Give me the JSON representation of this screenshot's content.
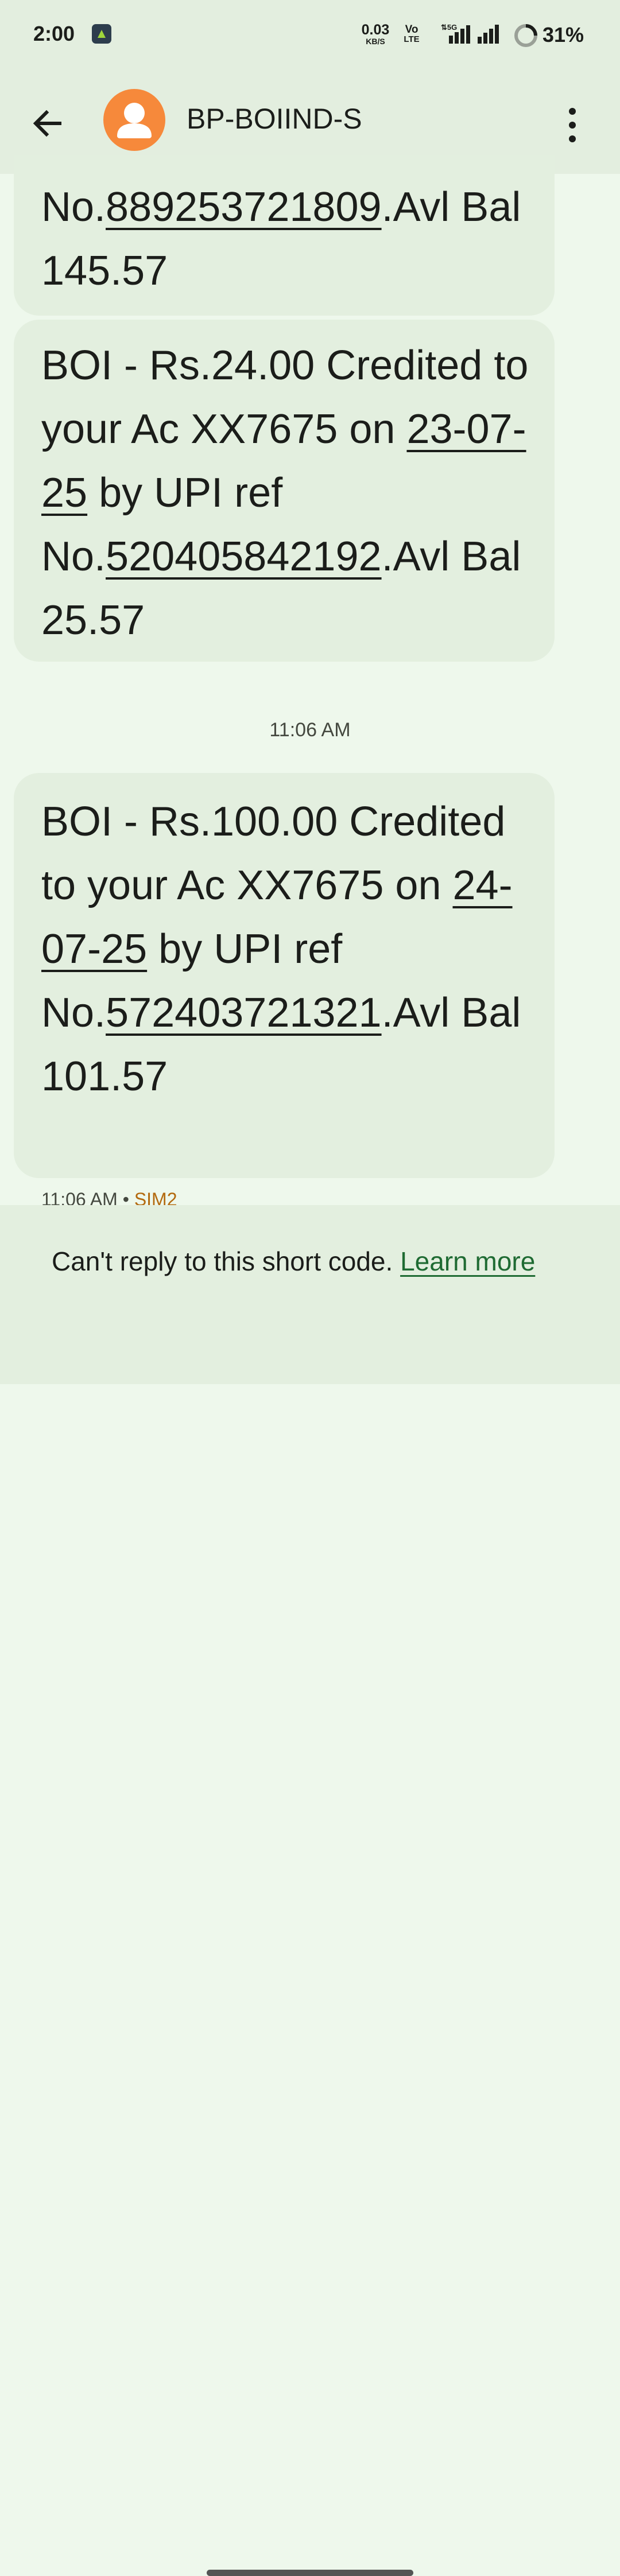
{
  "status_bar": {
    "time": "2:00",
    "net_speed_value": "0.03",
    "net_speed_unit": "KB/S",
    "volte_top": "Vo",
    "volte_bottom": "LTE",
    "network_type": "5G",
    "battery_percent": "31%"
  },
  "header": {
    "title": "BP-BOIIND-S",
    "avatar_color": "#f6893b"
  },
  "messages": [
    {
      "text_before_ref": "No.",
      "ref": "889253721809",
      "text_after_ref": ".Avl Bal 145.57"
    },
    {
      "prefix": "BOI -  Rs.24.00 Credited to your Ac XX7675 on ",
      "date": "23-07-25",
      "middle": " by UPI ref No.",
      "ref": "520405842192",
      "suffix": ".Avl Bal 25.57"
    },
    {
      "prefix": "BOI -  Rs.100.00 Credited to your Ac XX7675 on ",
      "date": "24-07-25",
      "middle": " by UPI ref No.",
      "ref": "572403721321",
      "suffix": ".Avl Bal 101.57"
    }
  ],
  "timestamp_divider": "11:06 AM",
  "message_meta": {
    "time": "11:06 AM",
    "separator": "•",
    "sim": "SIM2"
  },
  "notice": {
    "text": "Can't reply to this short code. ",
    "link": "Learn more"
  },
  "colors": {
    "background": "#eef8ec",
    "bar": "#e3eedf",
    "bubble": "#e3efdf",
    "link": "#1f6b33",
    "sim_label": "#b36a0f"
  }
}
